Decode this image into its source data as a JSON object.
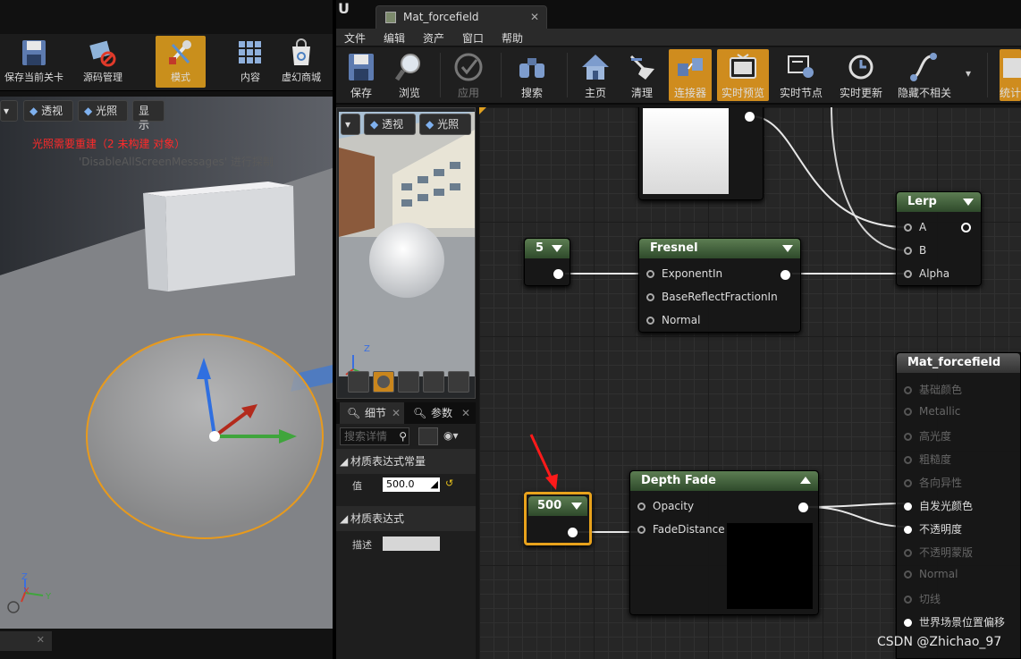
{
  "left_panel": {
    "toolbar": [
      {
        "label": "保存当前关卡",
        "icon": "save-level-icon"
      },
      {
        "label": "源码管理",
        "icon": "source-control-icon"
      },
      {
        "label": "模式",
        "icon": "modes-icon"
      },
      {
        "label": "内容",
        "icon": "content-icon"
      },
      {
        "label": "虚幻商城",
        "icon": "marketplace-icon"
      }
    ],
    "viewport": {
      "buttons": [
        "透视",
        "光照",
        "显示"
      ],
      "warning": "光照需要重建（2 未构建 对象）",
      "hint": "'DisableAllScreenMessages' 进行探制",
      "axis": {
        "z": "Z",
        "x": "X",
        "y": "Y"
      }
    }
  },
  "editor": {
    "tab_title": "Mat_forcefield",
    "menu": [
      "文件",
      "编辑",
      "资产",
      "窗口",
      "帮助"
    ],
    "toolbar": [
      {
        "label": "保存",
        "icon": "save-icon"
      },
      {
        "label": "浏览",
        "icon": "browse-icon"
      },
      {
        "label": "应用",
        "icon": "apply-icon"
      },
      {
        "label": "搜索",
        "icon": "search-icon"
      },
      {
        "label": "主页",
        "icon": "home-icon"
      },
      {
        "label": "清理",
        "icon": "clean-icon"
      },
      {
        "label": "连接器",
        "icon": "connectors-icon"
      },
      {
        "label": "实时预览",
        "icon": "live-preview-icon"
      },
      {
        "label": "实时节点",
        "icon": "live-nodes-icon"
      },
      {
        "label": "实时更新",
        "icon": "live-update-icon"
      },
      {
        "label": "隐藏不相关",
        "icon": "hide-unrelated-icon"
      },
      {
        "label": "统计",
        "icon": "stats-icon"
      }
    ],
    "preview": {
      "buttons": [
        "透视",
        "光照"
      ],
      "axis_z": "Z"
    },
    "details": {
      "tabs": [
        "细节",
        "参数"
      ],
      "search_placeholder": "搜索详情",
      "section1": "材质表达式常量",
      "value_label": "值",
      "value": "500.0",
      "section2": "材质表达式",
      "desc_label": "描述"
    },
    "graph": {
      "const5": "5",
      "fresnel": {
        "title": "Fresnel",
        "pins": [
          "ExponentIn",
          "BaseReflectFractionIn",
          "Normal"
        ]
      },
      "lerp": {
        "title": "Lerp",
        "pins": [
          "A",
          "B",
          "Alpha"
        ]
      },
      "const500": "500",
      "depth_fade": {
        "title": "Depth Fade",
        "pins": [
          "Opacity",
          "FadeDistance"
        ]
      },
      "material": {
        "title": "Mat_forcefield",
        "pins": [
          "基础颜色",
          "Metallic",
          "高光度",
          "粗糙度",
          "各向异性",
          "自发光颜色",
          "不透明度",
          "不透明蒙版",
          "Normal",
          "切线",
          "世界场景位置偏移"
        ],
        "active": [
          false,
          false,
          false,
          false,
          false,
          true,
          true,
          false,
          false,
          false,
          true
        ]
      }
    }
  },
  "watermark": "CSDN @Zhichao_97",
  "colors": {
    "accent": "#cf8c1e",
    "warning": "#ff2a2a",
    "selection": "#e8a21c",
    "node_header": "#4a6b40"
  }
}
